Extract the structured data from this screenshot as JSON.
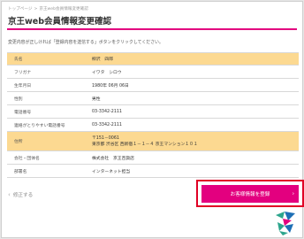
{
  "breadcrumb": {
    "home": "トップページ",
    "current": "京王web会員情報変更確認"
  },
  "page_title": "京王web会員情報変更確認",
  "instruction": "変更内容が正しければ「登録内容を送信する」ボタンをクリックしてください。",
  "rows": [
    {
      "label": "氏名",
      "value": "柳沢　四郎"
    },
    {
      "label": "フリガナ",
      "value": "イワタ　シロウ"
    },
    {
      "label": "生年月日",
      "value": "1980年 06月 06日"
    },
    {
      "label": "性別",
      "value": "男性"
    },
    {
      "label": "電話番号",
      "value": "03-3342-2111"
    },
    {
      "label": "連絡がとりやすい電話番号",
      "value": "03-3342-2111"
    },
    {
      "label": "住所",
      "postal": "〒151－0061",
      "address": "東京都 渋谷区 西新宿１－１－４ 京王マンション１０１"
    },
    {
      "label": "会社・団体名",
      "value": "株式会社　京王百貨店"
    },
    {
      "label": "部署名",
      "value": "インターネット担当"
    }
  ],
  "back_label": "修正する",
  "back_chevron": "‹",
  "submit_label": "お客様情報を登録",
  "submit_arrow": "›",
  "colors": {
    "accent": "#e3007f",
    "highlight_row": "#fcd991",
    "focus_outline": "#e00025"
  },
  "logo_icon": "keio-logo-icon"
}
